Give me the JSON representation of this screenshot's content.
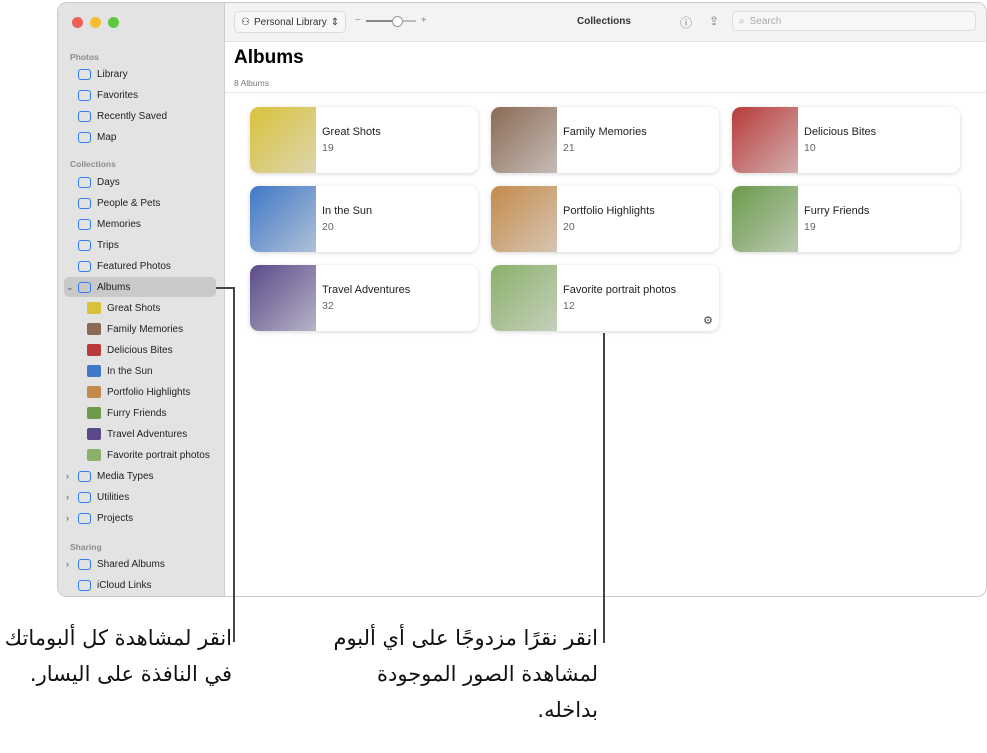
{
  "window": {
    "title": "Collections",
    "library": "Personal Library",
    "zoom_minus": "−",
    "zoom_plus": "+",
    "search_placeholder": "Search",
    "zoom_level": 0.6
  },
  "sidebar": {
    "photos_header": "Photos",
    "photos": [
      {
        "label": "Library"
      },
      {
        "label": "Favorites"
      },
      {
        "label": "Recently Saved"
      },
      {
        "label": "Map"
      }
    ],
    "collections_header": "Collections",
    "collections": [
      {
        "label": "Days"
      },
      {
        "label": "People & Pets"
      },
      {
        "label": "Memories"
      },
      {
        "label": "Trips"
      },
      {
        "label": "Featured Photos"
      },
      {
        "label": "Albums"
      }
    ],
    "albums": [
      {
        "label": "Great Shots"
      },
      {
        "label": "Family Memories"
      },
      {
        "label": "Delicious Bites"
      },
      {
        "label": "In the Sun"
      },
      {
        "label": "Portfolio Highlights"
      },
      {
        "label": "Furry Friends"
      },
      {
        "label": "Travel Adventures"
      },
      {
        "label": "Favorite portrait photos"
      }
    ],
    "more": [
      {
        "label": "Media Types"
      },
      {
        "label": "Utilities"
      },
      {
        "label": "Projects"
      }
    ],
    "sharing_header": "Sharing",
    "sharing": [
      {
        "label": "Shared Albums"
      },
      {
        "label": "iCloud Links"
      }
    ]
  },
  "main": {
    "title": "Albums",
    "count": "8 Albums",
    "albums": [
      {
        "name": "Great Shots",
        "count": "19",
        "color": "#d9c23a"
      },
      {
        "name": "Family Memories",
        "count": "21",
        "color": "#8a6a55"
      },
      {
        "name": "Delicious Bites",
        "count": "10",
        "color": "#b83a3a"
      },
      {
        "name": "In the Sun",
        "count": "20",
        "color": "#3f78c8"
      },
      {
        "name": "Portfolio Highlights",
        "count": "20",
        "color": "#c48a4a"
      },
      {
        "name": "Furry Friends",
        "count": "19",
        "color": "#6a9a4a"
      },
      {
        "name": "Travel Adventures",
        "count": "32",
        "color": "#5a4a8a"
      },
      {
        "name": "Favorite portrait photos",
        "count": "12",
        "color": "#8ab06a"
      }
    ]
  },
  "callouts": {
    "left": "انقر لمشاهدة كل ألبوماتك في النافذة على اليسار.",
    "right": "انقر نقرًا مزدوجًا على أي ألبوم لمشاهدة الصور الموجودة بداخله."
  }
}
